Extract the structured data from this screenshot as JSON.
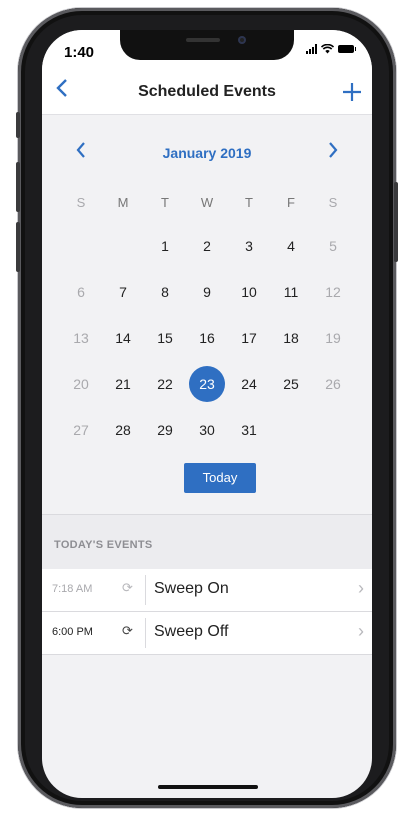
{
  "status": {
    "time": "1:40"
  },
  "nav": {
    "back_icon": "chevron-left-icon",
    "title": "Scheduled Events",
    "add_icon": "plus-icon"
  },
  "calendar": {
    "month_label": "January 2019",
    "weekdays": [
      "S",
      "M",
      "T",
      "W",
      "T",
      "F",
      "S"
    ],
    "weeks": [
      [
        "",
        "",
        "1",
        "2",
        "3",
        "4",
        "5"
      ],
      [
        "6",
        "7",
        "8",
        "9",
        "10",
        "11",
        "12"
      ],
      [
        "13",
        "14",
        "15",
        "16",
        "17",
        "18",
        "19"
      ],
      [
        "20",
        "21",
        "22",
        "23",
        "24",
        "25",
        "26"
      ],
      [
        "27",
        "28",
        "29",
        "30",
        "31",
        "",
        ""
      ]
    ],
    "selected_day": "23",
    "today_label": "Today"
  },
  "events": {
    "header": "TODAY'S EVENTS",
    "items": [
      {
        "time": "7:18 AM",
        "name": "Sweep On",
        "past": true
      },
      {
        "time": "6:00 PM",
        "name": "Sweep Off",
        "past": false
      }
    ]
  },
  "colors": {
    "accent": "#2f6fc2",
    "background": "#f2f2f4",
    "muted_text": "#a9a9ad"
  }
}
